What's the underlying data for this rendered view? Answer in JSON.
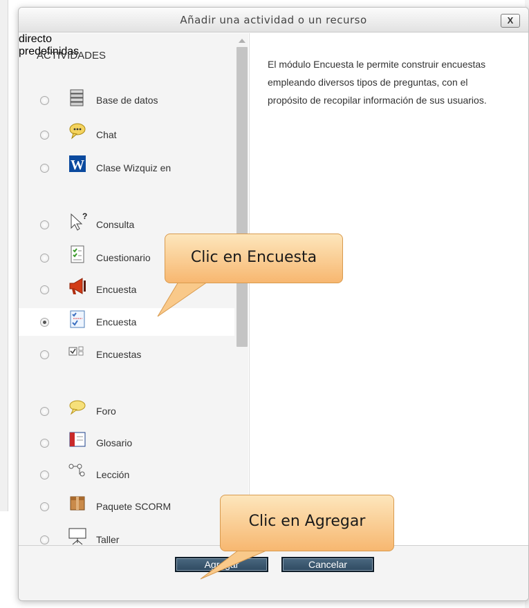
{
  "dialog": {
    "title": "Añadir una actividad o un recurso",
    "close_label": "X"
  },
  "options": {
    "section_label": "ACTIVIDADES",
    "items": [
      {
        "label": "Base de datos",
        "icon": "database-icon"
      },
      {
        "label": "Chat",
        "icon": "chat-bubble-icon"
      },
      {
        "label": "Clase Wizquiz en",
        "label_cont": "directo",
        "icon": "wizquiz-w-icon"
      },
      {
        "label": "Consulta",
        "icon": "choice-cursor-icon"
      },
      {
        "label": "Cuestionario",
        "icon": "quiz-checklist-icon"
      },
      {
        "label": "Encuesta",
        "icon": "megaphone-icon"
      },
      {
        "label": "Encuesta",
        "icon": "survey-chart-icon",
        "selected": true
      },
      {
        "label": "Encuestas",
        "label_cont": "predefinidas",
        "icon": "checkbox-survey-icon"
      },
      {
        "label": "Foro",
        "icon": "forum-bubble-icon"
      },
      {
        "label": "Glosario",
        "icon": "glossary-book-icon"
      },
      {
        "label": "Lección",
        "icon": "lesson-flow-icon"
      },
      {
        "label": "Paquete SCORM",
        "icon": "scorm-package-icon"
      },
      {
        "label": "Taller",
        "icon": "workshop-board-icon"
      }
    ]
  },
  "description": "El módulo Encuesta le permite construir encuestas empleando diversos tipos de preguntas, con el propósito de recopilar información de sus usuarios.",
  "footer": {
    "add_label": "Agregar",
    "cancel_label": "Cancelar"
  },
  "callouts": {
    "encuesta": "Clic en Encuesta",
    "agregar": "Clic en Agregar"
  },
  "colors": {
    "button_bg": "#3b566d",
    "callout_fill": "#f9c98a",
    "panel_bg": "#f4f4f4"
  }
}
